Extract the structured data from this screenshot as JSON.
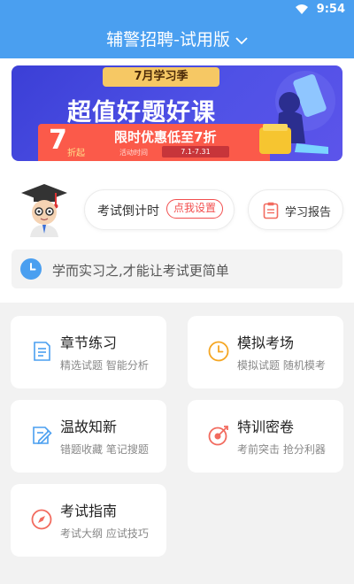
{
  "status_bar": {
    "time": "9:54",
    "wifi_icon": "wifi-icon"
  },
  "header": {
    "title": "辅警招聘-试用版",
    "dropdown_icon": "chevron-down-icon"
  },
  "banner": {
    "tag": "7月学习季",
    "headline": "超值好题好课",
    "discount_number": "7",
    "discount_suffix": "折起",
    "promo_title": "限时优惠低至7折",
    "activity_label": "活动时间",
    "activity_dates": "7.1-7.31"
  },
  "countdown": {
    "label": "考试倒计时",
    "action": "点我设置"
  },
  "report": {
    "label": "学习报告",
    "icon": "report-icon"
  },
  "motto": {
    "text": "学而实习之,才能让考试更简单",
    "icon": "clock-icon"
  },
  "features": [
    {
      "title": "章节练习",
      "subtitle": "精选试题 智能分析",
      "icon": "document-list-icon"
    },
    {
      "title": "模拟考场",
      "subtitle": "模拟试题 随机模考",
      "icon": "clock-icon"
    },
    {
      "title": "温故知新",
      "subtitle": "错题收藏 笔记搜题",
      "icon": "edit-document-icon"
    },
    {
      "title": "特训密卷",
      "subtitle": "考前突击 抢分利器",
      "icon": "target-icon"
    },
    {
      "title": "考试指南",
      "subtitle": "考试大纲 应试技巧",
      "icon": "compass-icon"
    }
  ],
  "colors": {
    "primary": "#4a9ff0",
    "accent_red": "#f24e4e",
    "banner_blue": "#4f51e6",
    "promo_red": "#fb5a4a"
  }
}
